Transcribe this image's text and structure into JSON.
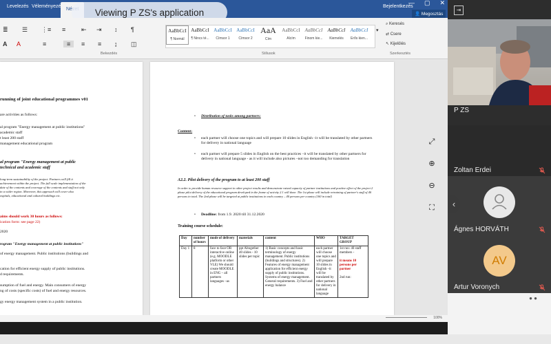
{
  "banner": {
    "text": "Viewing P ZS's application"
  },
  "ribbon": {
    "tabs": [
      "Levelezés",
      "Véleményezés",
      "Nézet"
    ],
    "right_tabs": [
      "Bejelentkezés",
      "Megosztás"
    ],
    "styles": [
      {
        "preview": "AaBbCcI",
        "name": "¶ Normál",
        "selected": true
      },
      {
        "preview": "AaBbCcI",
        "name": "¶ Nincs té..."
      },
      {
        "preview": "AaBbCcI",
        "name": "Címsor 1"
      },
      {
        "preview": "AaBbCcI",
        "name": "Címsor 2"
      },
      {
        "preview": "AaA",
        "name": "Cím"
      },
      {
        "preview": "AaBbCcI",
        "name": "Alcím"
      },
      {
        "preview": "AaBbCcI",
        "name": "Finom kie..."
      },
      {
        "preview": "AaBbCcI",
        "name": "Kiemelés"
      },
      {
        "preview": "AaBbCcI",
        "name": "Erős kien..."
      }
    ],
    "group_labels": [
      "Bekezdés",
      "Stílusok",
      "Szerkesztés"
    ],
    "edit_items": [
      "Keresés",
      "Csere",
      "Kijelölés"
    ]
  },
  "page_left": {
    "lines": [
      "running of joint educational programmes  v01",
      "are activities as follows:",
      "al program \"Energy management at public institutions\"",
      "academic staff",
      "t least 200 staff",
      "management educational program",
      "al program \"Energy management at public",
      "technical and academic staff",
      "long-term sustainability of the project. Partners will fill it",
      "achievement within the project. The full scale implementation of the",
      "date of the contents and coverage of the contents and staff not only",
      "in a wider region. Moreover, this approach will cover also",
      "ospitals, educational and cultural buildings etc.",
      "aims should work 30 hours as follows:",
      "ication form: see page 22)",
      "2020",
      "rogram \"Energy management at public institutions\"",
      "of energy management. Public institutions (buildings and",
      "cation for efficient energy supply of public institutions.",
      "d requirements.",
      "sumption of fuel and energy. Main consumers of energy",
      "ng of costs (specific costs) of fuel and energy resources.",
      "gy energy management system in a public institution."
    ]
  },
  "page_right": {
    "heading": "Distribution of tasks among partners:",
    "content_label": "Content:",
    "bullet1": "each partner will choose one topics and will prepare 10 slides in English –it will be translated by other partners for delivery in national language",
    "bullet2": "each partner will prepare 5 slides in English on the best practices –it will be translated by other partners for delivery in national language - as it will include also pictures –not too demanding for translation",
    "section": "A2.2. Pilot delivery of the program to at least 200 staff",
    "intro": "In order to provide human resource support in other project results and demonstrate raised capacity of partner institutions and positive effect of the project 2 phase pilot delivery of the educational program developed in the frame of activity 2.1 will done. The 1st phase will include retraining of partner's staff of 40 persons in total. The 2nd phase will be targeted at public institutions in each country – 40 persons per country (160 in total)",
    "deadline_label": "Deadline:",
    "deadline_value": "from 1.9. 2020 till 31.12.2020",
    "schedule_title": "Training course schedule:",
    "table_headers": [
      "Day",
      "number of hours",
      "mode of delivery",
      "materials",
      "content",
      "WHO",
      "TARGET GROUP"
    ],
    "row": {
      "day": "Day 1",
      "hours": "8",
      "mode": "face to face OR interactive online (e.g. MOODLE platform or other VLE) We should create MOODLE in ENG – all partners languages –as",
      "materials": "ppt Altogether 40 slides - 10 slides per topic",
      "content": "1) Basic concepts and basic terminology of energy management. Public institutions (buildings and structures). 2) Features of energy management application for efficient energy supply of public institutions. Systems of energy management. General requirements. 3) Fuel and energy balance",
      "who": "each partner will choose one topics and will prepare 10 slides in English –it will be translated by other partners for delivery in national language",
      "target_a": "1st run: 40 staff members -",
      "target_b": "it means 10 persons per partner",
      "target_c": "2nd run:"
    }
  },
  "statusbar": {
    "zoom": "100%"
  },
  "participants": [
    {
      "name": "P ZS",
      "type": "video"
    },
    {
      "name": "Zoltan Erdei",
      "type": "muted"
    },
    {
      "name": "Ágnes HORVÁTH",
      "type": "avatar-icon"
    },
    {
      "name": "Artur Voronych",
      "initials": "AV",
      "type": "avatar-initials"
    }
  ],
  "colors": {
    "word_blue": "#2b579a",
    "panel": "#2d2d2d",
    "muted_red": "#e05a4f",
    "av_bg": "#f3c98b",
    "av_fg": "#d07c00"
  }
}
